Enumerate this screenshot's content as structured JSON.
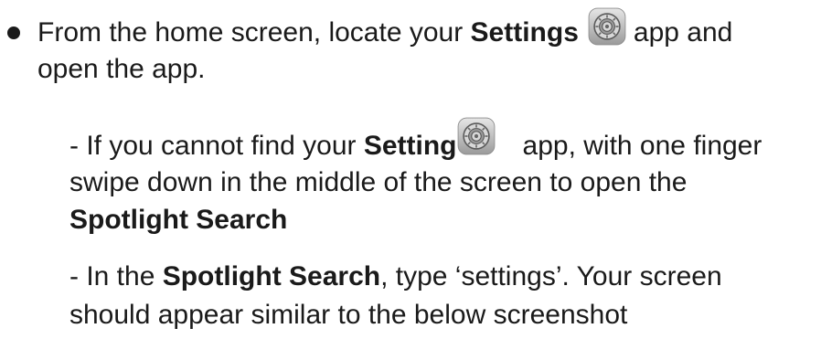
{
  "bullet": {
    "line1_a": "From the home screen, locate your ",
    "line1_bold": "Settings",
    "line1_b": "app and",
    "line2": "open the app."
  },
  "step1": {
    "line1_a": "- If you cannot find your ",
    "line1_bold": "Setting",
    "line1_b": "app, with one finger",
    "line2": "swipe down in the middle of the screen to open the",
    "line3_bold": "Spotlight Search"
  },
  "step2": {
    "line1_a": "- In the ",
    "line1_bold": "Spotlight Search",
    "line1_b": ", type ‘settings’. Your screen",
    "line2": "should appear similar to the below screenshot"
  },
  "icons": {
    "settings": "settings-gear-icon"
  }
}
